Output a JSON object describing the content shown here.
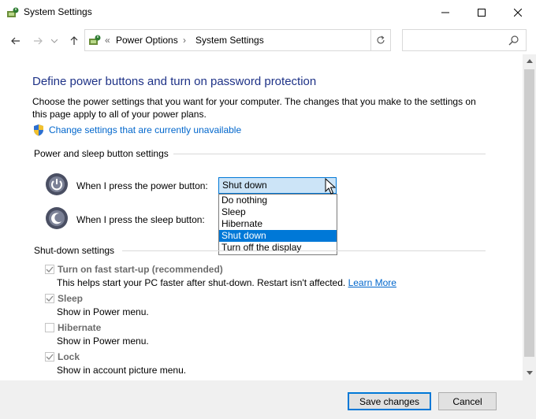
{
  "window": {
    "title": "System Settings"
  },
  "address": {
    "crumbs": [
      "Power Options",
      "System Settings"
    ],
    "search_placeholder": ""
  },
  "content": {
    "heading": "Define power buttons and turn on password protection",
    "description": "Choose the power settings that you want for your computer. The changes that you make to the settings on this page apply to all of your power plans.",
    "change_link": "Change settings that are currently unavailable",
    "power_group": {
      "label": "Power and sleep button settings",
      "power_button_label": "When I press the power button:",
      "sleep_button_label": "When I press the sleep button:",
      "power_button_value": "Shut down",
      "options": [
        "Do nothing",
        "Sleep",
        "Hibernate",
        "Shut down",
        "Turn off the display"
      ],
      "selected_index": 3
    },
    "shutdown_group": {
      "label": "Shut-down settings",
      "items": [
        {
          "label": "Turn on fast start-up (recommended)",
          "desc": "This helps start your PC faster after shut-down. Restart isn't affected.",
          "checked": true,
          "link": "Learn More"
        },
        {
          "label": "Sleep",
          "desc": "Show in Power menu.",
          "checked": true
        },
        {
          "label": "Hibernate",
          "desc": "Show in Power menu.",
          "checked": false
        },
        {
          "label": "Lock",
          "desc": "Show in account picture menu.",
          "checked": true
        }
      ]
    }
  },
  "footer": {
    "save_label": "Save changes",
    "cancel_label": "Cancel"
  },
  "colors": {
    "accent": "#0078d7",
    "heading": "#1e3287",
    "link": "#0066cc"
  }
}
